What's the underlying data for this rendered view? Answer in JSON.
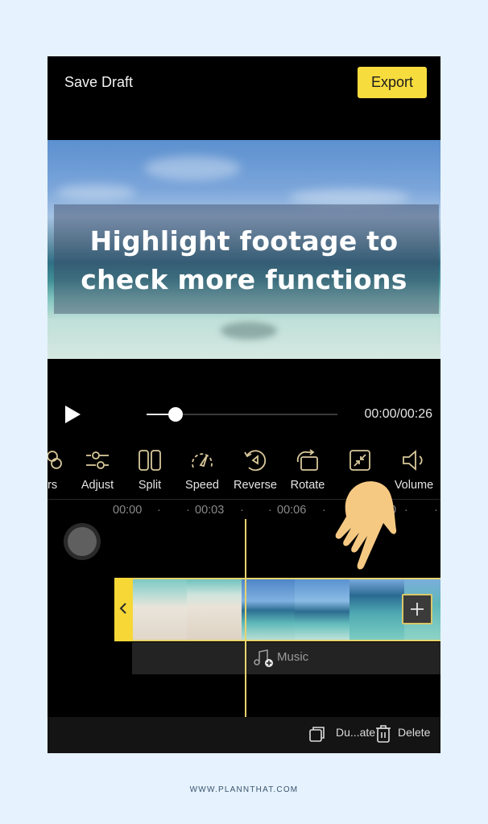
{
  "header": {
    "save_draft_label": "Save Draft",
    "export_label": "Export"
  },
  "preview": {
    "overlay_line1": "Highlight footage to",
    "overlay_line2": "check more functions"
  },
  "playback": {
    "play_icon": "play-icon",
    "progress_fraction": 0.15,
    "time_readout": "00:00/00:26"
  },
  "toolbar": {
    "items": [
      {
        "label": "ers",
        "icon": "filters-icon"
      },
      {
        "label": "Adjust",
        "icon": "adjust-sliders-icon"
      },
      {
        "label": "Split",
        "icon": "split-icon"
      },
      {
        "label": "Speed",
        "icon": "speedometer-icon"
      },
      {
        "label": "Reverse",
        "icon": "reverse-icon"
      },
      {
        "label": "Rotate",
        "icon": "rotate-icon"
      },
      {
        "label": "",
        "icon": "crop-shrink-icon"
      },
      {
        "label": "Volume",
        "icon": "volume-icon"
      }
    ]
  },
  "timeline": {
    "ticks": [
      "00:00",
      "00:03",
      "00:06",
      "0"
    ],
    "music_label": "Music",
    "add_clip_icon": "plus-icon"
  },
  "bottom_bar": {
    "duplicate_label": "Du...ate",
    "delete_label": "Delete"
  },
  "colors": {
    "accent_yellow": "#f7dc3e",
    "hand": "#f6c983",
    "background": "#e6f2fd"
  },
  "footer": {
    "site": "WWW.PLANNTHAT.COM"
  }
}
